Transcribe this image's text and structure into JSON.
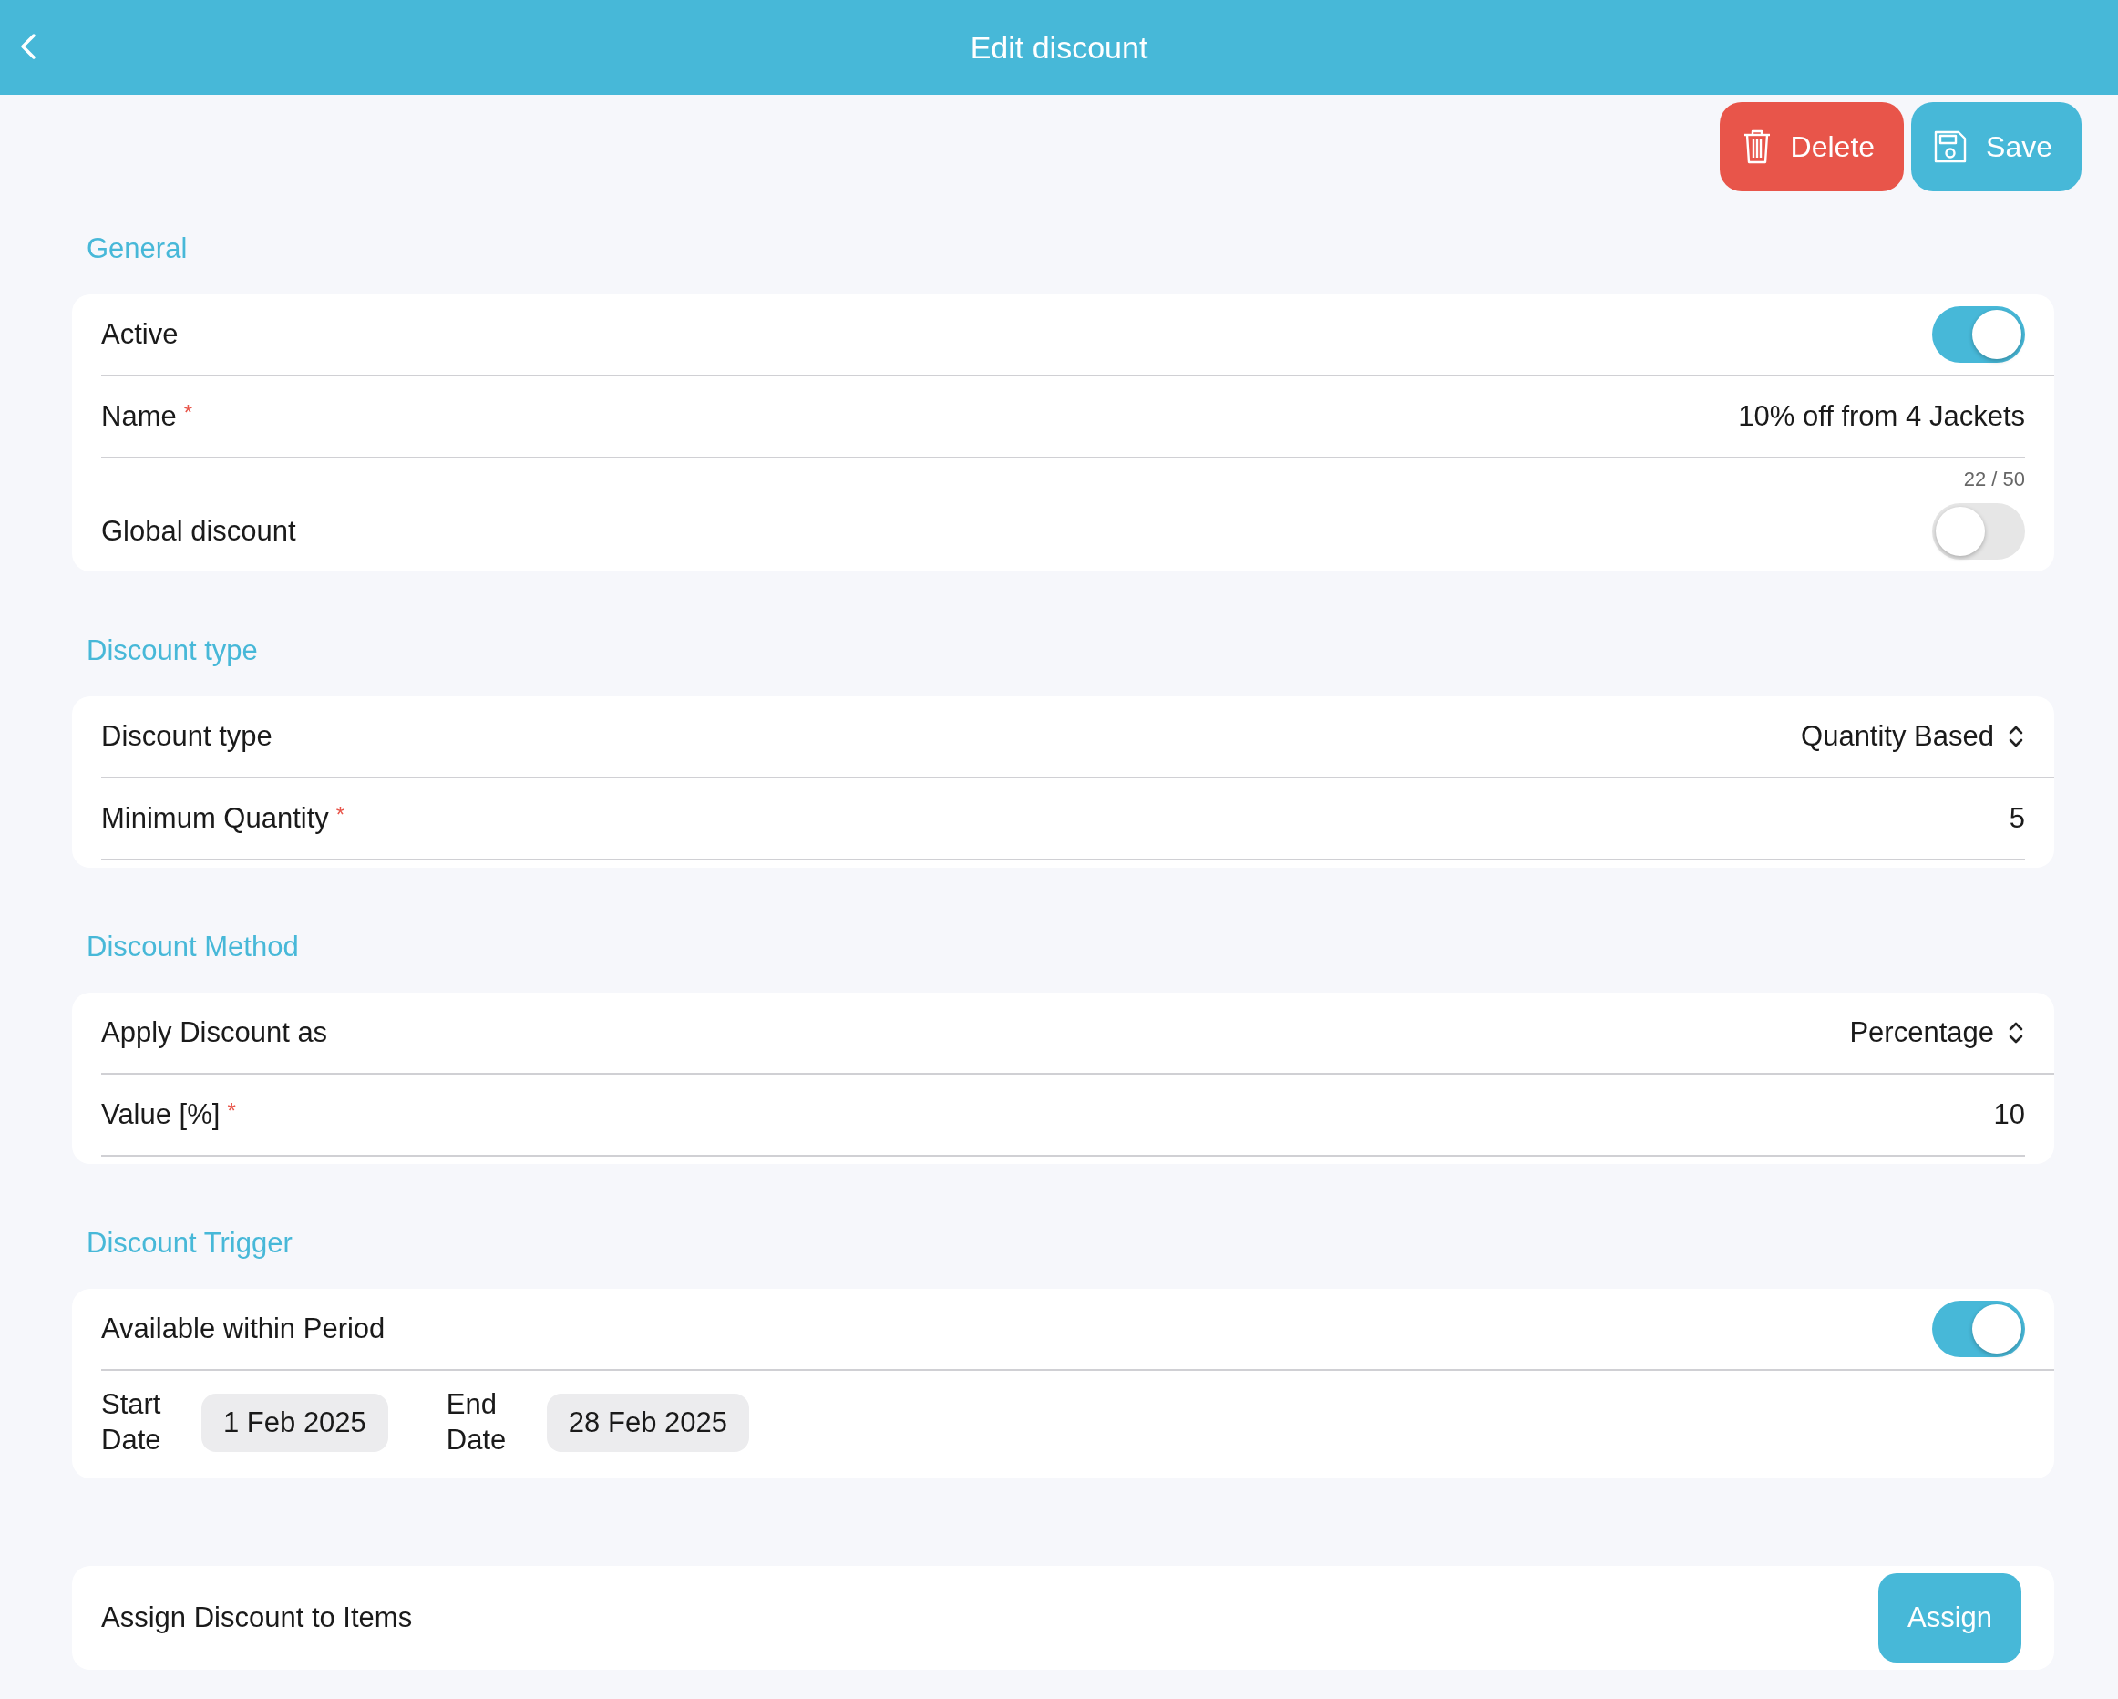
{
  "header": {
    "title": "Edit discount"
  },
  "actions": [
    {
      "label": "Delete",
      "kind": "delete"
    },
    {
      "label": "Save",
      "kind": "save"
    }
  ],
  "sections": [
    {
      "title": "General",
      "rows": [
        {
          "kind": "toggle",
          "label": "Active",
          "on": true
        },
        {
          "kind": "field",
          "label": "Name",
          "required": "*",
          "value": "10% off from 4 Jackets",
          "counter": "22 / 50"
        },
        {
          "kind": "toggle",
          "label": "Global discount",
          "on": false
        }
      ]
    },
    {
      "title": "Discount type",
      "rows": [
        {
          "kind": "select",
          "label": "Discount type",
          "value": "Quantity Based"
        },
        {
          "kind": "field",
          "label": "Minimum Quantity",
          "required": "*",
          "value": "5"
        }
      ]
    },
    {
      "title": "Discount Method",
      "rows": [
        {
          "kind": "select",
          "label": "Apply Discount as",
          "value": "Percentage"
        },
        {
          "kind": "field",
          "label": "Value [%]",
          "required": "*",
          "value": "10"
        }
      ]
    },
    {
      "title": "Discount Trigger",
      "rows": [
        {
          "kind": "toggle",
          "label": "Available within Period",
          "on": true
        },
        {
          "kind": "dates",
          "items": [
            {
              "label": "Start Date",
              "value": "1 Feb 2025"
            },
            {
              "label": "End Date",
              "value": "28 Feb 2025"
            }
          ]
        }
      ]
    }
  ],
  "assign": {
    "label": "Assign Discount to Items",
    "button": "Assign"
  }
}
